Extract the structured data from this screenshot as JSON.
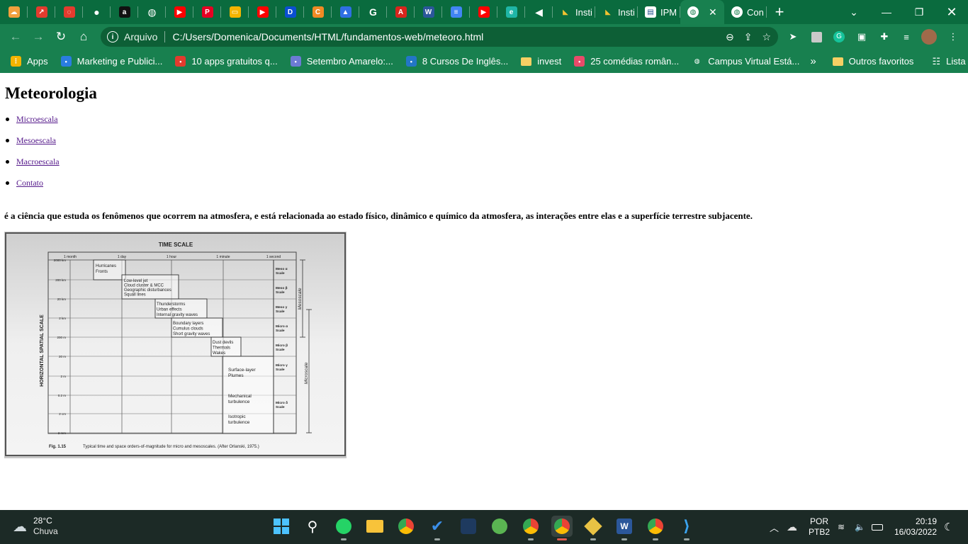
{
  "browser": {
    "pinned_tabs": [
      {
        "icon": "cloud-icon",
        "color": "#f2a03d"
      },
      {
        "icon": "trending-icon",
        "color": "#e33b2e"
      },
      {
        "icon": "circle-dashed-icon",
        "color": "#e33b2e"
      },
      {
        "icon": "github-icon",
        "color": "#ffffff"
      },
      {
        "icon": "letter-a-icon",
        "color": "#111111"
      },
      {
        "icon": "globe-icon",
        "color": "#ffffff"
      },
      {
        "icon": "youtube-icon",
        "color": "#ff0000"
      },
      {
        "icon": "pinterest-icon",
        "color": "#e60023"
      },
      {
        "icon": "slides-icon",
        "color": "#f4b400"
      },
      {
        "icon": "youtube-icon",
        "color": "#ff0000"
      },
      {
        "icon": "blue-d-icon",
        "color": "#0b4fd1"
      },
      {
        "icon": "orange-c-icon",
        "color": "#f08a24"
      },
      {
        "icon": "drive-triangle-icon",
        "color": "#2f6fe4"
      },
      {
        "icon": "google-icon",
        "color": "#ffffff"
      },
      {
        "icon": "pdf-icon",
        "color": "#d8251d"
      },
      {
        "icon": "word-icon",
        "color": "#2b579a"
      },
      {
        "icon": "docs-icon",
        "color": "#4285f4"
      },
      {
        "icon": "youtube-icon",
        "color": "#ff0000"
      },
      {
        "icon": "e-icon",
        "color": "#1fb6a6"
      },
      {
        "icon": "speaker-icon",
        "color": "#ffffff"
      }
    ],
    "titled_tabs": [
      {
        "title": "Insti",
        "icon": "google-drive-icon"
      },
      {
        "title": "Insti",
        "icon": "google-drive-icon"
      },
      {
        "title": "IPM",
        "icon": "ipm-icon"
      }
    ],
    "active_tab": {
      "title": "",
      "icon": "globe-icon"
    },
    "last_tab": {
      "title": "Con",
      "icon": "globe-icon"
    },
    "omnibox": {
      "label": "Arquivo",
      "url": "C:/Users/Domenica/Documents/HTML/fundamentos-web/meteoro.html"
    },
    "bookmarks": [
      {
        "label": "Apps",
        "icon": "apps-grid-icon",
        "color": "#f4b400"
      },
      {
        "label": "Marketing e Publici...",
        "icon": "mkt-icon",
        "color": "#2a7de1"
      },
      {
        "label": "10 apps gratuitos q...",
        "icon": "trending-icon",
        "color": "#e33b2e"
      },
      {
        "label": "Setembro Amarelo:...",
        "icon": "ev-icon",
        "color": "#6c7bd4"
      },
      {
        "label": "8 Cursos De Inglês...",
        "icon": "e-icon",
        "color": "#2376c7"
      },
      {
        "label": "invest",
        "icon": "folder-icon",
        "color": "#f5d064"
      },
      {
        "label": "25 comédias român...",
        "icon": "ticket-icon",
        "color": "#e94b6a"
      },
      {
        "label": "Campus Virtual Está...",
        "icon": "globe-icon",
        "color": "#ffffff"
      }
    ],
    "bookmarks_overflow": "»",
    "other_favorites": "Outros favoritos",
    "reading_list": "Lista de leitura"
  },
  "page": {
    "title": "Meteorologia",
    "nav": [
      "Microescala",
      "Mesoescala",
      "Macroescala",
      "Contato"
    ],
    "description": "é a ciência que estuda os fenômenos que ocorrem na atmosfera, e está relacionada ao estado físico, dinâmico e químico da atmosfera, as interações entre elas e a superfície terrestre subjacente.",
    "figure": {
      "title": "TIME SCALE",
      "time_ticks": [
        "1 month",
        "1 day",
        "1 hour",
        "1 minute",
        "1 second"
      ],
      "y_label": "HORIZONTAL SPATIAL SCALE",
      "space_ticks": [
        "2000 km",
        "200 km",
        "20 km",
        "2 km",
        "200 m",
        "20 m",
        "2 m",
        "0.2 m",
        "2 cm",
        "2 mm"
      ],
      "phenomena": [
        {
          "lines": [
            "Hurricanes",
            "Fronts"
          ]
        },
        {
          "lines": [
            "Low-level jet",
            "Cloud cluster & MCC",
            "Geographic disturbances",
            "Squall lines"
          ]
        },
        {
          "lines": [
            "Thunderstorms",
            "Urban effects",
            "Internal gravity waves"
          ]
        },
        {
          "lines": [
            "Boundary layers",
            "Cumulus clouds",
            "Short gravity waves"
          ]
        },
        {
          "lines": [
            "Dust devils",
            "Thermals",
            "Wakes"
          ]
        },
        {
          "lines": [
            "Surface-layer",
            "Plumes"
          ]
        },
        {
          "lines": [
            "Mechanical",
            "turbulence"
          ]
        },
        {
          "lines": [
            "Isotropic",
            "turbulence"
          ]
        }
      ],
      "scale_names": [
        [
          "Meso α",
          "Scale"
        ],
        [
          "Meso β",
          "Scale"
        ],
        [
          "Meso γ",
          "Scale"
        ],
        [
          "Micro α",
          "Scale"
        ],
        [
          "Micro β",
          "Scale"
        ],
        [
          "Micro γ",
          "Scale"
        ],
        [
          "Micro δ",
          "Scale"
        ]
      ],
      "range_labels": [
        "Mesoscale",
        "Microscale"
      ],
      "caption_label": "Fig. 1.15",
      "caption": "Typical time and space orders-of-magnitude for micro and mesoscales. (After Orlanski, 1975.)"
    }
  },
  "taskbar": {
    "temperature": "28°C",
    "condition": "Chuva",
    "language": "POR",
    "layout": "PTB2",
    "time": "20:19",
    "date": "16/03/2022"
  }
}
